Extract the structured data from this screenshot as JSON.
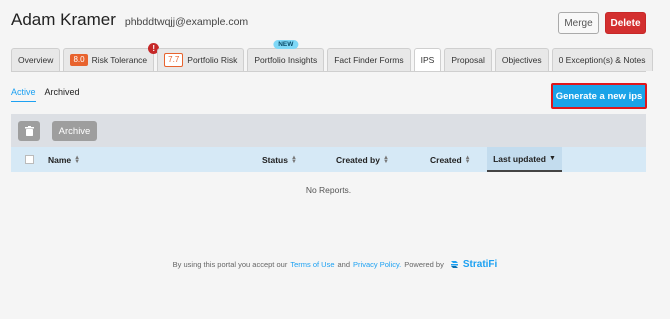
{
  "client": {
    "name": "Adam Kramer",
    "email": "phbddtwqjj@example.com"
  },
  "actions": {
    "merge_label": "Merge",
    "delete_label": "Delete"
  },
  "tabs": [
    {
      "label": "Overview"
    },
    {
      "label": "Risk Tolerance",
      "score": "8.0",
      "alert": "!"
    },
    {
      "label": "Portfolio Risk",
      "score": "7.7"
    },
    {
      "label": "Portfolio Insights",
      "badge": "NEW"
    },
    {
      "label": "Fact Finder Forms"
    },
    {
      "label": "IPS",
      "active": true
    },
    {
      "label": "Proposal"
    },
    {
      "label": "Objectives"
    },
    {
      "label": "0 Exception(s) & Notes"
    }
  ],
  "subtabs": {
    "active": "Active",
    "archived": "Archived"
  },
  "generate_label": "Generate a new ips",
  "toolbar": {
    "archive_label": "Archive",
    "trash_icon": "trash-icon"
  },
  "table": {
    "columns": {
      "name": "Name",
      "status": "Status",
      "created_by": "Created by",
      "created": "Created",
      "last_updated": "Last updated"
    },
    "sorted_by": "Last updated",
    "empty_text": "No Reports."
  },
  "footer": {
    "prefix": "By using this portal you accept our",
    "terms": "Terms of Use",
    "and": "and",
    "privacy": "Privacy Policy.",
    "powered": "Powered by",
    "brand": "StratiFi"
  },
  "colors": {
    "accent": "#1da1f2",
    "delete": "#d32f2f",
    "score": "#e8632e",
    "highlight_border": "#e0161b"
  }
}
